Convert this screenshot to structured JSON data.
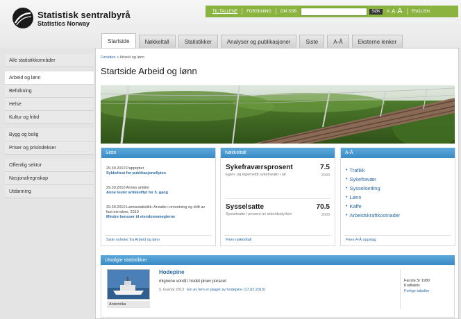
{
  "brand": {
    "name": "Statistisk sentralbyrå",
    "sub": "Statistics Norway"
  },
  "topbar": {
    "links": [
      "TIL TALLENE",
      "FORSKNING",
      "OM SSB"
    ],
    "search_button": "SØK",
    "font_sizes": [
      "A",
      "A",
      "A"
    ],
    "lang": "ENGLISH"
  },
  "tabs": [
    "Startside",
    "Nøkkeltall",
    "Statistikker",
    "Analyser og publikasjoner",
    "Siste",
    "A-Å",
    "Eksterne lenker"
  ],
  "sidebar": [
    "Alle statistikkområder",
    "Arbeid og lønn",
    "Befolkning",
    "Helse",
    "Kultur og fritid",
    "Bygg og bolig",
    "Priser og prisindekser",
    "Offentlig sektor",
    "Nasjonalregnskap",
    "Utdanning"
  ],
  "breadcrumb": {
    "home": "Forsiden",
    "current": "Arbeid og lønn"
  },
  "page_title": "Startside Arbeid og lønn",
  "siste": {
    "heading": "Siste",
    "items": [
      {
        "meta": "29.30.2010 Pappopter",
        "link": "Sykkeltest for publikasjonsflyten"
      },
      {
        "meta": "29.30.2010 Annes artikler",
        "link": "Anne tester artikkelflyt for 5. gang"
      },
      {
        "meta": "29.30.2010 Lønnsstatistikk: Ansatte i omsetning og drift av fast eiendom, 2010",
        "link": "Mindre benuser til eiendomsmeglerne"
      }
    ],
    "footer": "Siste nyheter fra Arbeid og lønn"
  },
  "nokkeltall": {
    "heading": "Nøkkeltall",
    "items": [
      {
        "title": "Sykefraværsprosent",
        "value": "7.5",
        "desc": "Egen- og legemeldt sykefravær i alt",
        "year": "2009"
      },
      {
        "title": "Sysselsatte",
        "value": "70.5",
        "desc": "Sysselsatte i prosent av arbeidsstyrken",
        "year": "2009"
      }
    ],
    "footer": "Flere nøkkeltall"
  },
  "aa": {
    "heading": "A-Å",
    "items": [
      "Trafikk",
      "Sykefravær",
      "Sysselsetting",
      "Lønn",
      "Kaffe",
      "Arbeidskraftkostnader"
    ],
    "footer": "Flere A-Å oppslag"
  },
  "utvalgte": {
    "heading": "Utvalgte statistikker",
    "thumb_caption": "Antennika",
    "title": "Hodepine",
    "desc": "mignone vondt i hodet pinev poracet",
    "meta_prefix": "5. kvartal 2013 · ",
    "meta_link": "En av fem er plaget av hodepine (17.02.2013)",
    "side": [
      "Fanste 5r 1980",
      "Kraftaktiv"
    ],
    "side_link": "Forlige tabeller"
  },
  "colors": {
    "accent_green": "#8bb340",
    "box_blue": "#3a8bc7",
    "link_blue": "#2b6aa6"
  }
}
